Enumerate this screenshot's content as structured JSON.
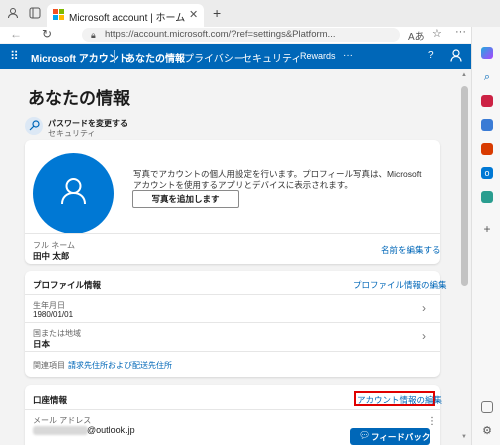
{
  "browser": {
    "tab_title": "Microsoft account | ホーム",
    "url": "https://account.microsoft.com/?ref=settings&Platform..."
  },
  "nav": {
    "brand": "Microsoft アカウント",
    "items": [
      "あなたの情報",
      "プライバシー",
      "セキュリティ",
      "Rewards",
      "···"
    ],
    "help": "?",
    "profile_icon": "person-icon"
  },
  "page": {
    "title": "あなたの情報",
    "password": {
      "label": "パスワードを変更する",
      "sub": "セキュリティ"
    }
  },
  "profile_card": {
    "description": "写真でアカウントの個人用設定を行います。プロフィール写真は、Microsoft アカウントを使用するアプリとデバイスに表示されます。",
    "add_photo": "写真を追加します",
    "fullname_label": "フル ネーム",
    "fullname_value": "田中 太郎",
    "edit_name": "名前を編集する"
  },
  "profile_info": {
    "title": "プロファイル情報",
    "edit": "プロファイル情報の編集",
    "dob_label": "生年月日",
    "dob_value": "1980/01/01",
    "region_label": "国または地域",
    "region_value": "日本",
    "related_label": "関連項目",
    "related_link": "請求先住所および配送先住所"
  },
  "account_info": {
    "title": "口座情報",
    "edit": "アカウント情報の編集",
    "email_label": "メール アドレス",
    "email_value": "@outlook.jp",
    "feedback": "フィードバック"
  },
  "colors": {
    "accent": "#0067b8",
    "highlight": "#e00000"
  }
}
